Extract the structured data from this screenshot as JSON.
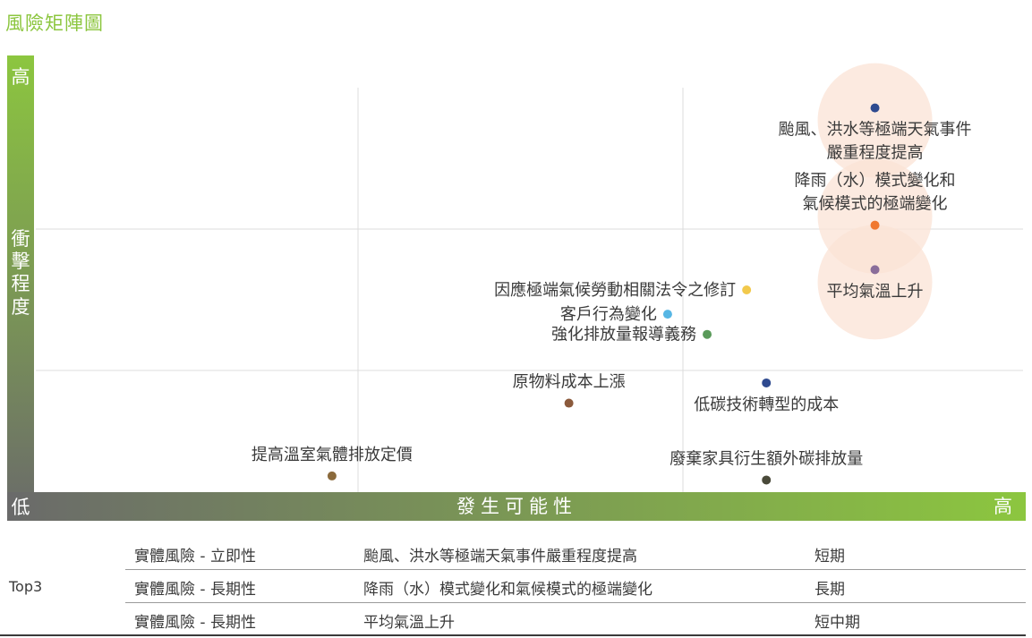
{
  "title": "風險矩陣圖",
  "chart_data": {
    "type": "scatter",
    "xlabel": "發生可能性",
    "ylabel": "衝擊程度",
    "x_low_label": "低",
    "x_high_label": "高",
    "y_low_label": "低",
    "y_high_label": "高",
    "xlim": [
      0,
      10
    ],
    "ylim": [
      0,
      10
    ],
    "grid": true,
    "points": [
      {
        "label": "颱風、洪水等極端天氣事件\n嚴重程度提高",
        "x": 8.5,
        "y": 9.5,
        "color": "#2e4a8f",
        "label_pos": "below",
        "highlight": true
      },
      {
        "label": "降雨（水）模式變化和\n氣候模式的極端變化",
        "x": 8.5,
        "y": 6.6,
        "color": "#f07830",
        "label_pos": "above",
        "highlight": true
      },
      {
        "label": "平均氣溫上升",
        "x": 8.5,
        "y": 5.5,
        "color": "#8a6d9a",
        "label_pos": "below",
        "highlight": true
      },
      {
        "label": "因應極端氣候勞動相關法令之修訂",
        "x": 7.2,
        "y": 5.0,
        "color": "#f2c94c",
        "label_pos": "left"
      },
      {
        "label": "客戶行為變化",
        "x": 6.4,
        "y": 4.4,
        "color": "#56b6e4",
        "label_pos": "left"
      },
      {
        "label": "強化排放量報導義務",
        "x": 6.8,
        "y": 3.9,
        "color": "#5a9a5a",
        "label_pos": "left"
      },
      {
        "label": "低碳技術轉型的成本",
        "x": 7.4,
        "y": 2.7,
        "color": "#2e4a8f",
        "label_pos": "below"
      },
      {
        "label": "原物料成本上漲",
        "x": 5.4,
        "y": 2.2,
        "color": "#8b5a3c",
        "label_pos": "above"
      },
      {
        "label": "提高溫室氣體排放定價",
        "x": 3.0,
        "y": 0.4,
        "color": "#8b6a3c",
        "label_pos": "above"
      },
      {
        "label": "廢棄家具衍生額外碳排放量",
        "x": 7.4,
        "y": 0.3,
        "color": "#4a4a3a",
        "label_pos": "above"
      }
    ]
  },
  "table": {
    "top_label": "Top3",
    "rows": [
      {
        "category": "實體風險 - 立即性",
        "risk": "颱風、洪水等極端天氣事件嚴重程度提高",
        "term": "短期"
      },
      {
        "category": "實體風險 - 長期性",
        "risk": "降雨（水）模式變化和氣候模式的極端變化",
        "term": "長期"
      },
      {
        "category": "實體風險 - 長期性",
        "risk": "平均氣溫上升",
        "term": "短中期"
      }
    ]
  },
  "colors": {
    "accent": "#8cc63f",
    "axis_dark": "#666666",
    "highlight": "#fbe3d6"
  }
}
